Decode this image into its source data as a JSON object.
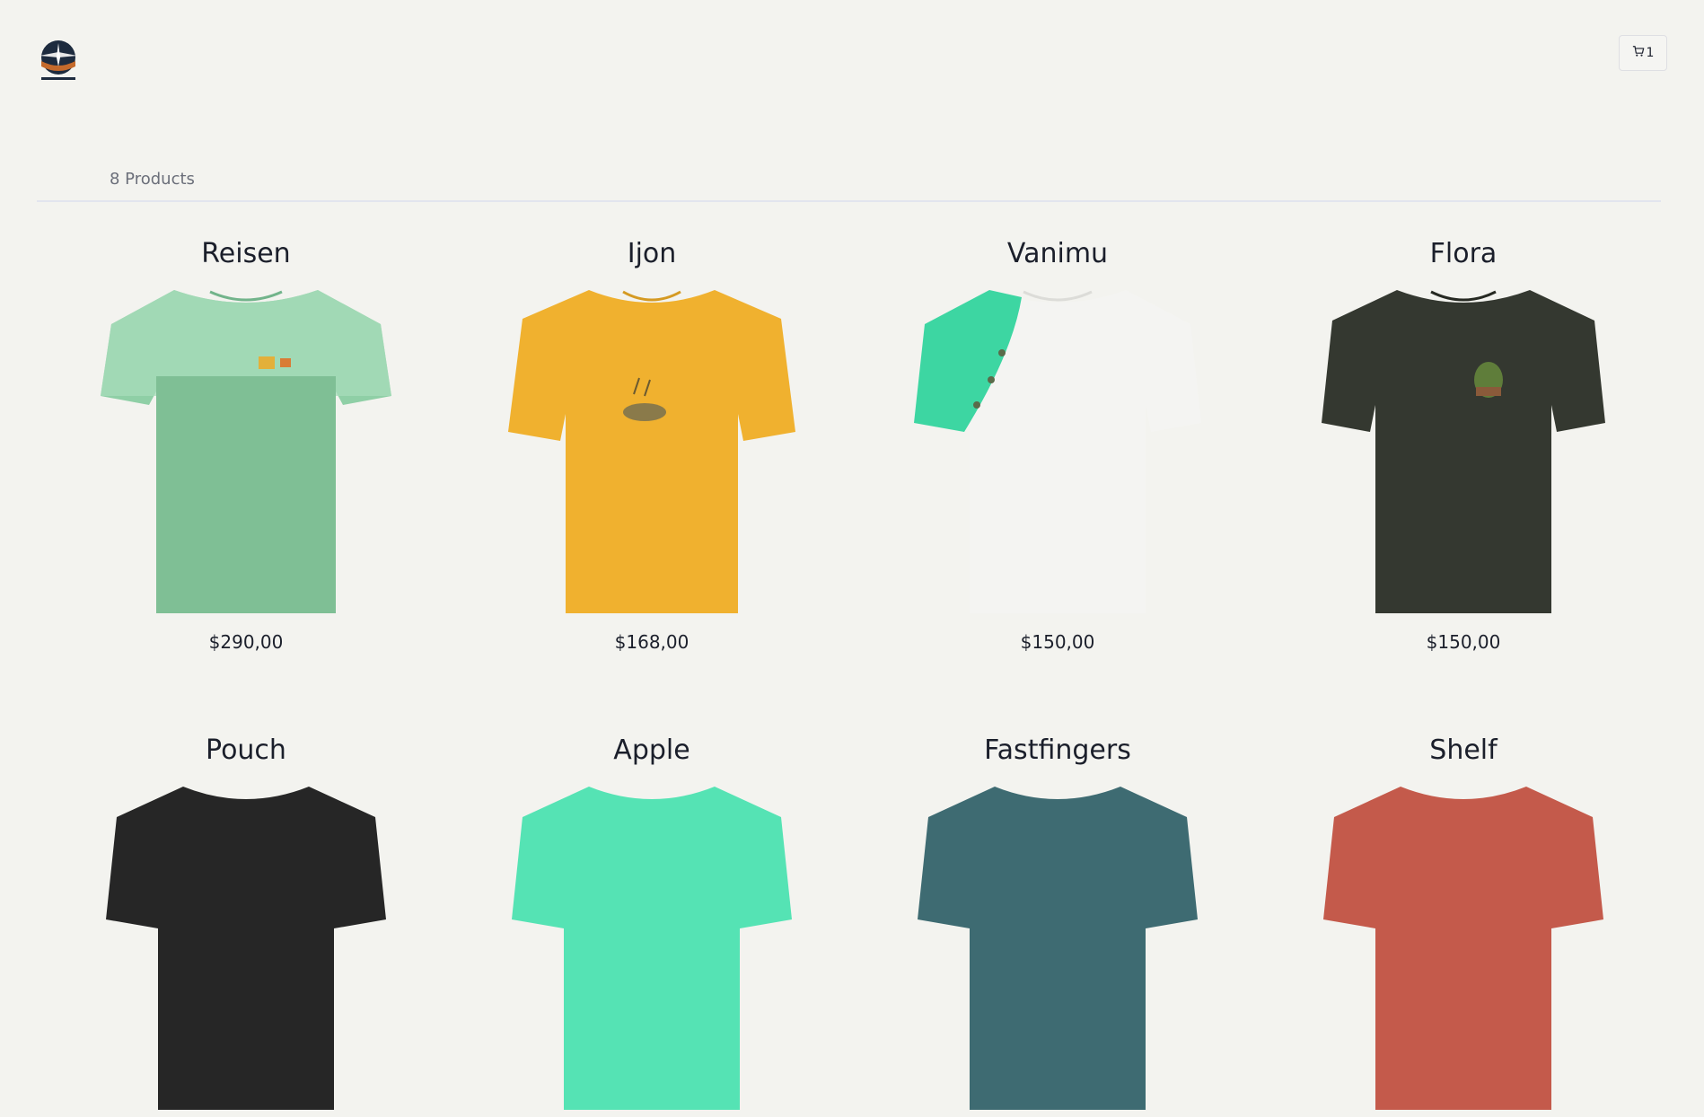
{
  "header": {
    "logo_icon": "brand-logo-icon",
    "cart": {
      "icon": "cart-icon",
      "count": "1"
    }
  },
  "listing": {
    "count_label": "8 Products"
  },
  "products": [
    {
      "name": "Reisen",
      "price": "$290,00",
      "color": "#8fcfa6",
      "graphic": "beach-scene"
    },
    {
      "name": "Ijon",
      "price": "$168,00",
      "color": "#f0b12f",
      "graphic": "boat-scene"
    },
    {
      "name": "Vanimu",
      "price": "$150,00",
      "color": "#f4f4f2",
      "accent": "#3dd6a2",
      "graphic": "climbers"
    },
    {
      "name": "Flora",
      "price": "$150,00",
      "color": "#343830",
      "graphic": "plant"
    },
    {
      "name": "Pouch",
      "price": "",
      "color": "#262626"
    },
    {
      "name": "Apple",
      "price": "",
      "color": "#55e3b4"
    },
    {
      "name": "Fastfingers",
      "price": "",
      "color": "#3e6b72"
    },
    {
      "name": "Shelf",
      "price": "",
      "color": "#c45a4b"
    }
  ]
}
